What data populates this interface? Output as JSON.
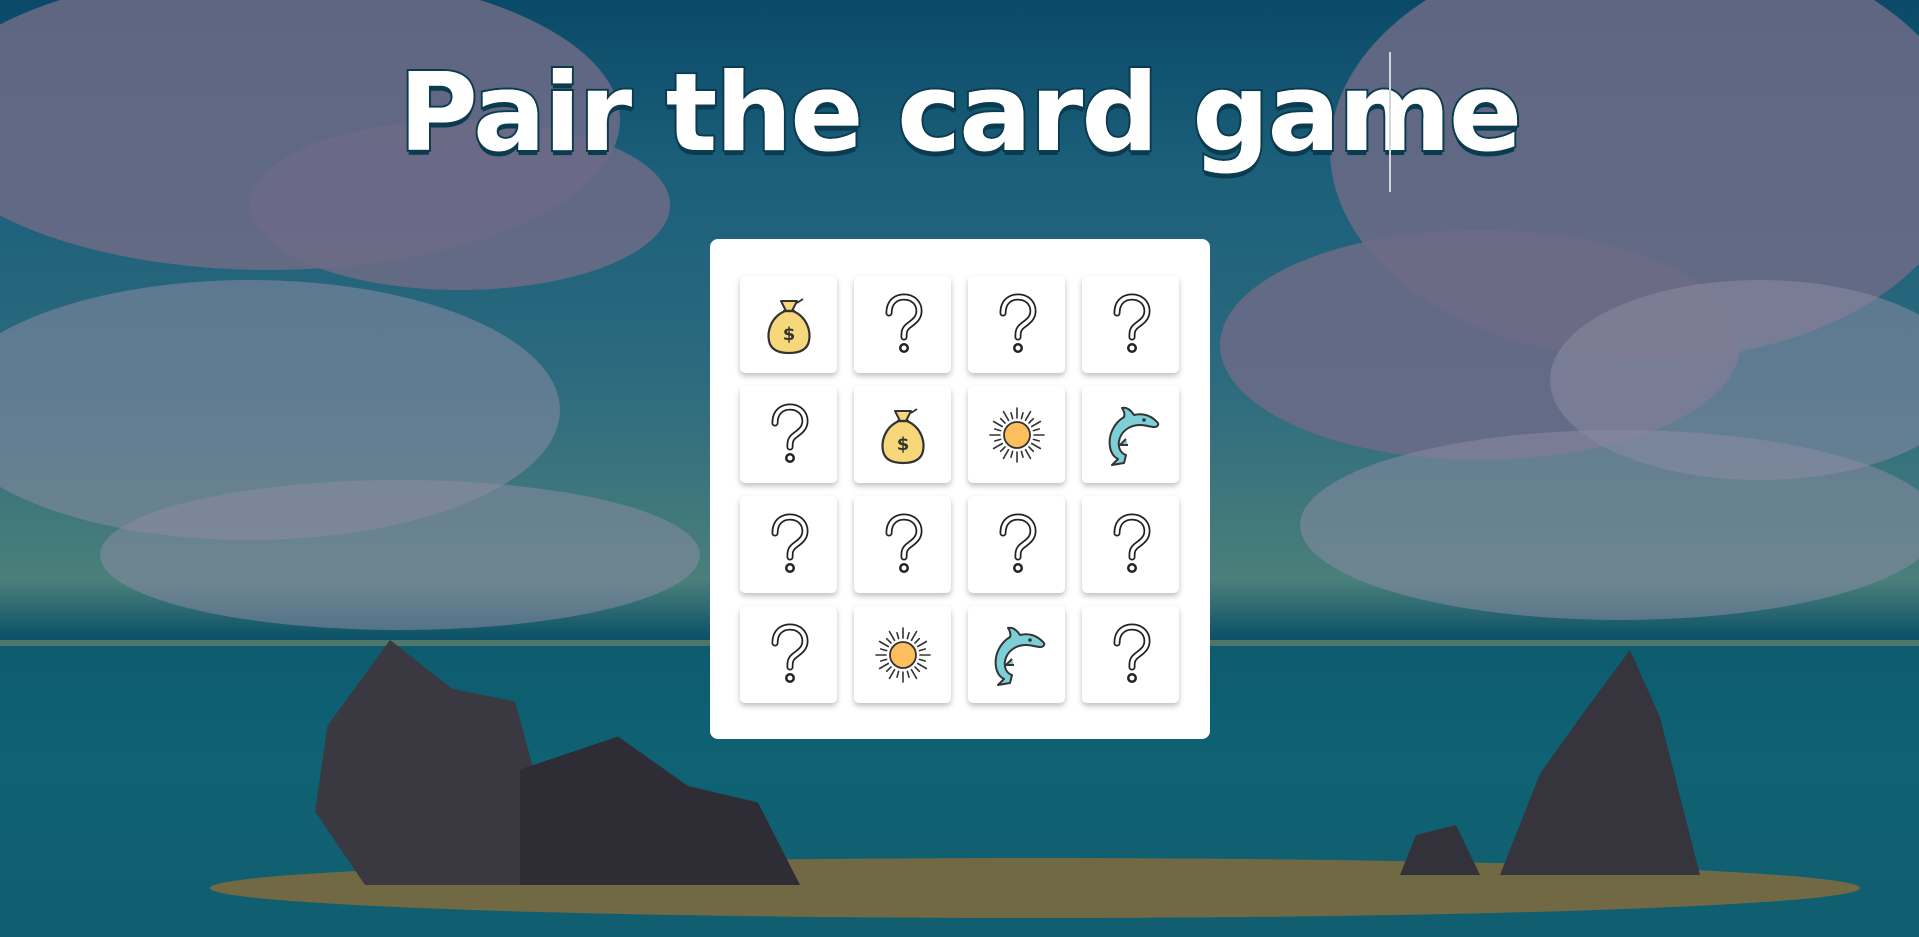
{
  "title": "Pair the card game",
  "board": {
    "cards": [
      {
        "state": "revealed",
        "icon": "money-bag-icon"
      },
      {
        "state": "hidden",
        "icon": "question-mark-icon"
      },
      {
        "state": "hidden",
        "icon": "question-mark-icon"
      },
      {
        "state": "hidden",
        "icon": "question-mark-icon"
      },
      {
        "state": "hidden",
        "icon": "question-mark-icon"
      },
      {
        "state": "revealed",
        "icon": "money-bag-icon"
      },
      {
        "state": "revealed",
        "icon": "sun-icon"
      },
      {
        "state": "revealed",
        "icon": "dolphin-icon"
      },
      {
        "state": "hidden",
        "icon": "question-mark-icon"
      },
      {
        "state": "hidden",
        "icon": "question-mark-icon"
      },
      {
        "state": "hidden",
        "icon": "question-mark-icon"
      },
      {
        "state": "hidden",
        "icon": "question-mark-icon"
      },
      {
        "state": "hidden",
        "icon": "question-mark-icon"
      },
      {
        "state": "revealed",
        "icon": "sun-icon"
      },
      {
        "state": "revealed",
        "icon": "dolphin-icon"
      },
      {
        "state": "hidden",
        "icon": "question-mark-icon"
      }
    ]
  },
  "colors": {
    "card_background": "#ffffff",
    "board_background": "#ffffff",
    "title_fill": "#ffffff",
    "title_outline": "#0b3b4f",
    "money_bag": "#f6d77a",
    "sun": "#fbbf5e",
    "dolphin": "#7ccfd6"
  }
}
